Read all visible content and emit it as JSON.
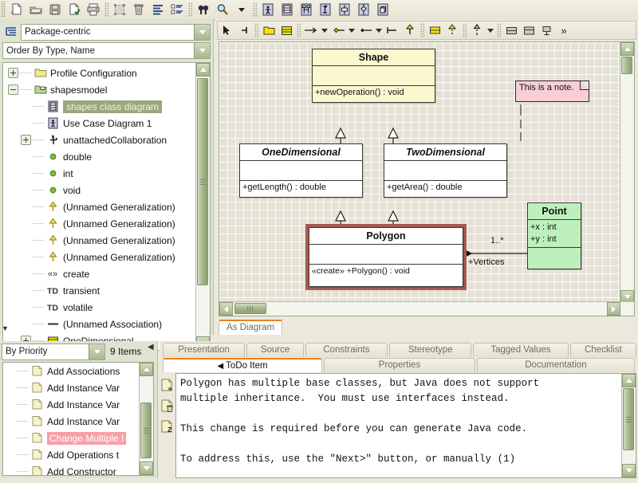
{
  "toolbar": {
    "groups": [
      {
        "name": "file",
        "buttons": [
          {
            "name": "new-icon",
            "title": "New"
          },
          {
            "name": "open-icon",
            "title": "Open Project"
          },
          {
            "name": "save-icon",
            "title": "Save Project"
          },
          {
            "name": "save-as-icon",
            "title": "Save Project As"
          },
          {
            "name": "print-icon",
            "title": "Print"
          }
        ]
      },
      {
        "name": "edit",
        "buttons": [
          {
            "name": "select-all-icon",
            "title": "Select All"
          },
          {
            "name": "delete-icon",
            "title": "Remove From Model"
          },
          {
            "name": "properties-icon",
            "title": "Properties"
          },
          {
            "name": "settings-icon",
            "title": "Settings"
          }
        ]
      },
      {
        "name": "find",
        "buttons": [
          {
            "name": "find-icon",
            "title": "Find"
          },
          {
            "name": "zoom-icon",
            "title": "Zoom"
          },
          {
            "name": "zoom-dropdown-icon",
            "title": "Zoom options"
          }
        ]
      },
      {
        "name": "create-diagram",
        "buttons": [
          {
            "name": "usecase-diagram-icon",
            "title": "New Use Case Diagram"
          },
          {
            "name": "class-diagram-icon",
            "title": "New Class Diagram"
          },
          {
            "name": "sequence-diagram-icon",
            "title": "New Sequence Diagram"
          },
          {
            "name": "collaboration-diagram-icon",
            "title": "New Collaboration Diagram"
          },
          {
            "name": "state-diagram-icon",
            "title": "New State Diagram"
          },
          {
            "name": "activity-diagram-icon",
            "title": "New Activity Diagram"
          },
          {
            "name": "deployment-diagram-icon",
            "title": "New Deployment Diagram"
          }
        ]
      }
    ]
  },
  "explorer": {
    "perspective_combo": {
      "value": "Package-centric",
      "icon": "perspective-icon"
    },
    "order_combo": {
      "value": "Order By Type, Name"
    },
    "tree": [
      {
        "label": "Profile Configuration",
        "icon": "folder-icon",
        "expander": "plus",
        "indent": 0,
        "selected": false
      },
      {
        "label": "shapesmodel",
        "icon": "model-folder-icon",
        "expander": "minus",
        "indent": 0,
        "selected": false
      },
      {
        "label": "shapes class diagram",
        "icon": "class-diagram-icon",
        "expander": "none",
        "indent": 1,
        "selected": true
      },
      {
        "label": "Use Case Diagram 1",
        "icon": "usecase-diagram-icon",
        "expander": "none",
        "indent": 1,
        "selected": false
      },
      {
        "label": "unattachedCollaboration",
        "icon": "collaboration-icon",
        "expander": "plus",
        "indent": 1,
        "selected": false
      },
      {
        "label": "double",
        "icon": "datatype-icon",
        "expander": "none",
        "indent": 1,
        "selected": false
      },
      {
        "label": "int",
        "icon": "datatype-icon",
        "expander": "none",
        "indent": 1,
        "selected": false
      },
      {
        "label": "void",
        "icon": "datatype-icon",
        "expander": "none",
        "indent": 1,
        "selected": false
      },
      {
        "label": "(Unnamed Generalization)",
        "icon": "generalization-icon",
        "expander": "none",
        "indent": 1,
        "selected": false
      },
      {
        "label": "(Unnamed Generalization)",
        "icon": "generalization-icon",
        "expander": "none",
        "indent": 1,
        "selected": false
      },
      {
        "label": "(Unnamed Generalization)",
        "icon": "generalization-icon",
        "expander": "none",
        "indent": 1,
        "selected": false
      },
      {
        "label": "(Unnamed Generalization)",
        "icon": "generalization-icon",
        "expander": "none",
        "indent": 1,
        "selected": false
      },
      {
        "label": "create",
        "icon": "stereotype-icon",
        "expander": "none",
        "indent": 1,
        "selected": false
      },
      {
        "label": "transient",
        "icon": "tagdefinition-icon",
        "expander": "none",
        "indent": 1,
        "selected": false
      },
      {
        "label": "volatile",
        "icon": "tagdefinition-icon",
        "expander": "none",
        "indent": 1,
        "selected": false
      },
      {
        "label": "(Unnamed Association)",
        "icon": "association-icon",
        "expander": "none",
        "indent": 1,
        "selected": false
      },
      {
        "label": "OneDimensional",
        "icon": "class-icon",
        "expander": "plus",
        "indent": 1,
        "selected": false
      }
    ]
  },
  "diagram_toolbar": {
    "buttons": [
      {
        "name": "select-tool-icon",
        "title": "Select"
      },
      {
        "name": "broom-tool-icon",
        "title": "Broom"
      },
      {
        "name": "new-package-icon",
        "title": "New Package"
      },
      {
        "name": "new-class-icon",
        "title": "New Class"
      },
      {
        "name": "new-association-icon",
        "title": "New Association"
      },
      {
        "name": "association-dropdown-icon",
        "title": "Association options"
      },
      {
        "name": "new-aggregation-icon",
        "title": "New Aggregation"
      },
      {
        "name": "aggregation-dropdown-icon",
        "title": "Aggregation options"
      },
      {
        "name": "new-composition-icon",
        "title": "New Composition"
      },
      {
        "name": "composition-dropdown-icon",
        "title": "Composition options"
      },
      {
        "name": "new-association-end-icon",
        "title": "New Association End"
      },
      {
        "name": "new-generalization-icon",
        "title": "New Generalization"
      },
      {
        "name": "new-interface-icon",
        "title": "New Interface"
      },
      {
        "name": "new-realization-icon",
        "title": "New Realization"
      },
      {
        "name": "new-dependency-icon",
        "title": "New Dependency"
      },
      {
        "name": "dependency-dropdown-icon",
        "title": "Dependency options"
      },
      {
        "name": "new-datatype-icon",
        "title": "New Data Type"
      },
      {
        "name": "new-enumeration-icon",
        "title": "New Enumeration"
      },
      {
        "name": "new-stereotype-icon",
        "title": "New Stereotype"
      },
      {
        "name": "overflow-icon",
        "title": "More"
      }
    ],
    "overflow_label": "»"
  },
  "diagram": {
    "tab_label": "As Diagram",
    "classes": [
      {
        "name": "Shape",
        "italic": false,
        "fill": "yellow",
        "attributes": [],
        "operations": [
          "+newOperation() : void"
        ]
      },
      {
        "name": "OneDimensional",
        "italic": true,
        "fill": "white",
        "attributes": [],
        "operations": [
          "+getLength() : double"
        ]
      },
      {
        "name": "TwoDimensional",
        "italic": true,
        "fill": "white",
        "attributes": [],
        "operations": [
          "+getArea() : double"
        ]
      },
      {
        "name": "Polygon",
        "italic": false,
        "fill": "white",
        "selected": true,
        "attributes": [],
        "operations": [
          "«create» +Polygon() : void"
        ]
      },
      {
        "name": "Point",
        "italic": false,
        "fill": "green",
        "attributes": [
          "+x : int",
          "+y : int"
        ],
        "operations": []
      }
    ],
    "note": {
      "text": "This is a note."
    },
    "association_labels": {
      "multiplicity": "1..*",
      "role": "+Vertices"
    }
  },
  "todo_panel": {
    "sort_combo": {
      "value": "By Priority"
    },
    "items_count": "9 Items",
    "items": [
      {
        "label": "Add Associations",
        "selected": false
      },
      {
        "label": "Add Instance Var",
        "selected": false
      },
      {
        "label": "Add Instance Var",
        "selected": false
      },
      {
        "label": "Add Instance Var",
        "selected": false
      },
      {
        "label": "Change Multiple I",
        "selected": true
      },
      {
        "label": "Add Operations t",
        "selected": false
      },
      {
        "label": "Add Constructor",
        "selected": false
      }
    ]
  },
  "details": {
    "tabs_row1": [
      {
        "label": "Presentation",
        "active": false
      },
      {
        "label": "Source",
        "active": false
      },
      {
        "label": "Constraints",
        "active": false
      },
      {
        "label": "Stereotype",
        "active": false
      },
      {
        "label": "Tagged Values",
        "active": false
      },
      {
        "label": "Checklist",
        "active": false
      }
    ],
    "tabs_row2": [
      {
        "label": "ToDo Item",
        "active": true
      },
      {
        "label": "Properties",
        "active": false
      },
      {
        "label": "Documentation",
        "active": false
      }
    ],
    "collapse_glyph": "◀",
    "side_buttons": [
      {
        "name": "new-todo-item-icon",
        "title": "New To Do Item"
      },
      {
        "name": "delete-todo-item-icon",
        "title": "Delete To Do Item"
      },
      {
        "name": "snooze-todo-item-icon",
        "title": "Snooze Critic"
      }
    ],
    "todo_text": "Polygon has multiple base classes, but Java does not support\nmultiple inheritance.  You must use interfaces instead.\n\nThis change is required before you can generate Java code.\n\nTo address this, use the \"Next>\" button, or manually (1)"
  },
  "colors": {
    "accent_orange": "#e8821e",
    "olive": "#9fb184",
    "panel_bg": "#dfe3d2",
    "canvas_bg": "#e6e1d5",
    "class_yellow": "#fbf8cf",
    "class_green": "#bdf0bd",
    "note_pink": "#f7cdd6",
    "selection_red": "#a55a52",
    "tree_selection": "#9aa87a",
    "todo_selection": "#f7a0a8"
  }
}
